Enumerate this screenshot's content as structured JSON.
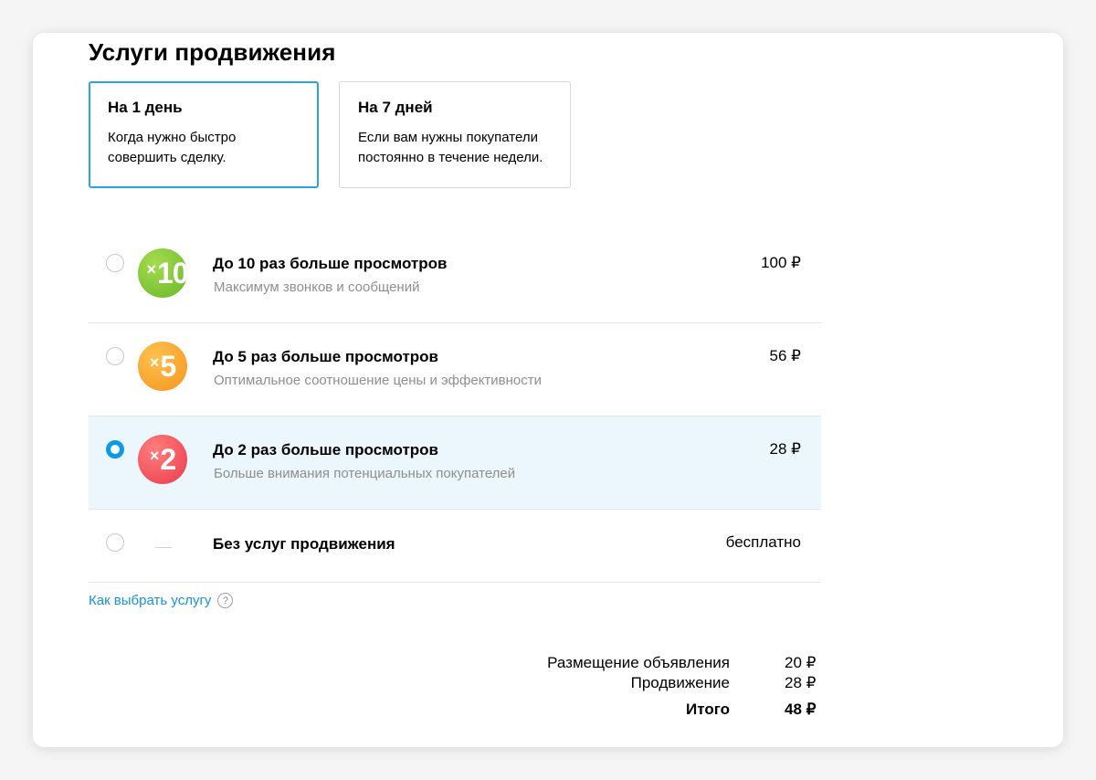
{
  "title": "Услуги продвижения",
  "tabs": [
    {
      "title": "На 1 день",
      "desc_line1": "Когда нужно быстро",
      "desc_line2": "совершить сделку."
    },
    {
      "title": "На 7 дней",
      "desc_line1": "Если вам нужны покупатели",
      "desc_line2": "постоянно в течение недели."
    }
  ],
  "options": [
    {
      "badge_x": "×",
      "badge_n": "10",
      "title": "До 10 раз больше просмотров",
      "subtitle": "Максимум звонков и сообщений",
      "price": "100 ₽",
      "color": "#7cc63a"
    },
    {
      "badge_x": "×",
      "badge_n": "5",
      "title": "До 5 раз больше просмотров",
      "subtitle": "Оптимальное соотношение цены и эффективности",
      "price": "56 ₽",
      "color": "#f7a12a"
    },
    {
      "badge_x": "×",
      "badge_n": "2",
      "title": "До 2 раз больше просмотров",
      "subtitle": "Больше внимания потенциальных покупателей",
      "price": "28 ₽",
      "color": "#ef5058"
    },
    {
      "title": "Без услуг продвижения",
      "price": "бесплатно"
    }
  ],
  "selected_option": 2,
  "help_link": "Как выбрать услугу",
  "help_icon": "?",
  "summary": {
    "placement_label": "Размещение объявления",
    "placement_value": "20 ₽",
    "promotion_label": "Продвижение",
    "promotion_value": "28 ₽",
    "total_label": "Итого",
    "total_value": "48 ₽"
  },
  "accent_color": "#0c9ae4",
  "link_color": "#1a90d9"
}
